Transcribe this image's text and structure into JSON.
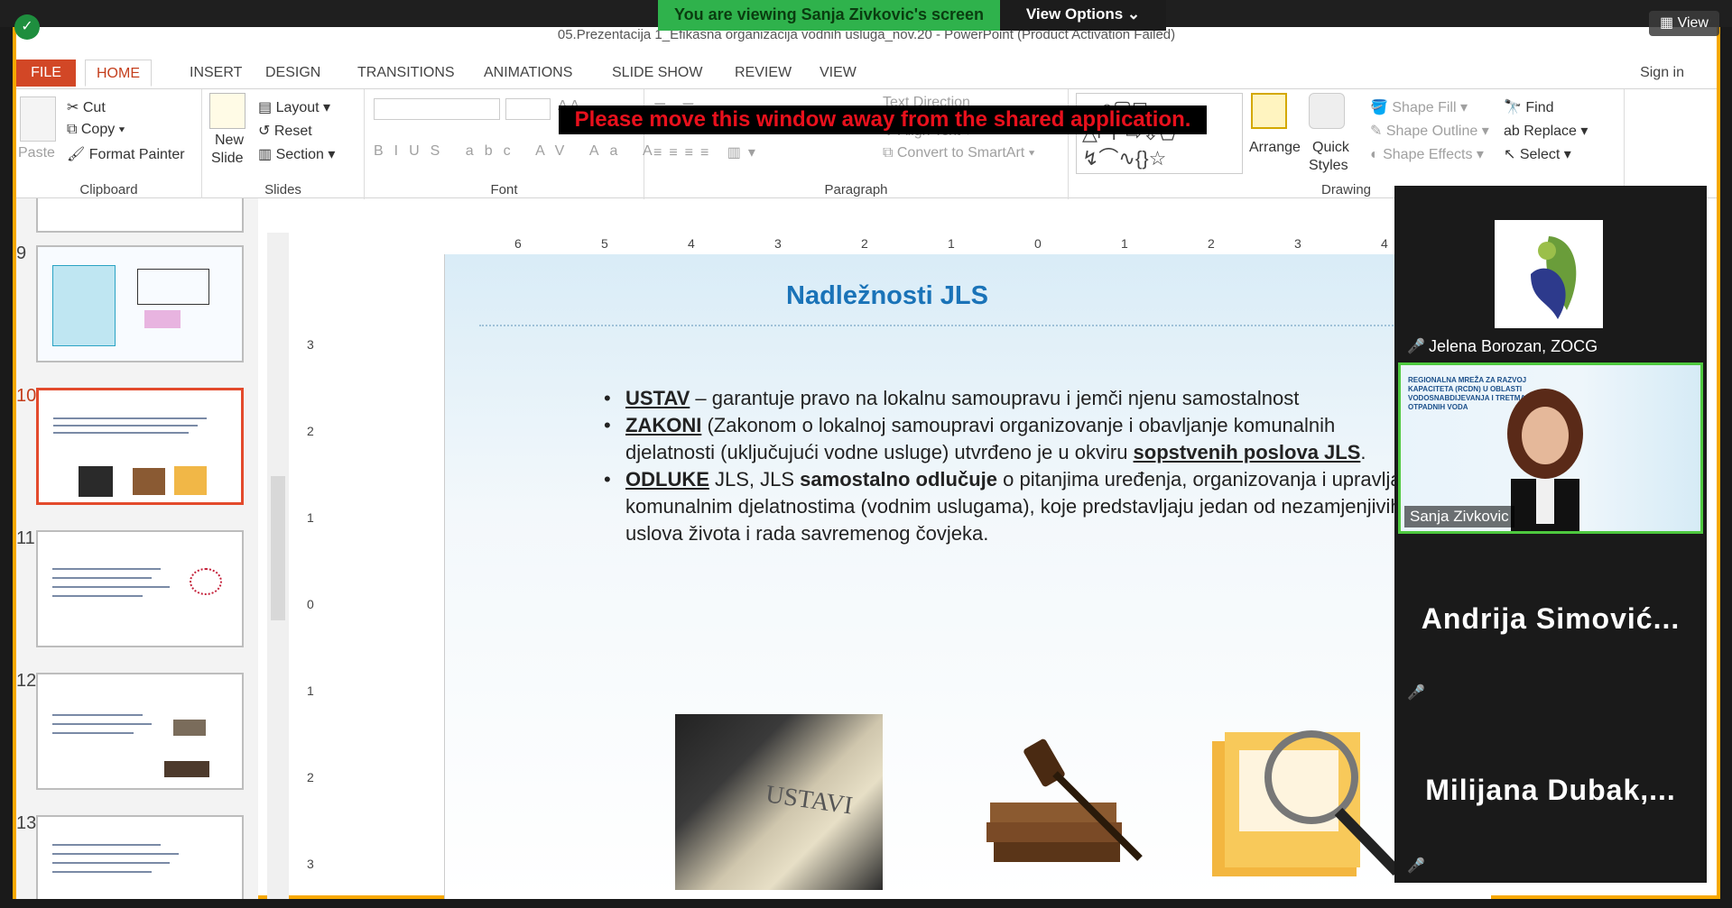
{
  "zoom": {
    "viewing_banner": "You are viewing Sanja Zivkovic's screen",
    "view_options": "View Options",
    "view_button": "View",
    "share_warning": "Please move this window away from the shared application."
  },
  "ppt": {
    "title": "05.Prezentacija 1_Efikasna organizacija vodnih usluga_nov.20 - PowerPoint (Product Activation Failed)",
    "tabs": [
      "FILE",
      "HOME",
      "INSERT",
      "DESIGN",
      "TRANSITIONS",
      "ANIMATIONS",
      "SLIDE SHOW",
      "REVIEW",
      "VIEW"
    ],
    "sign_in": "Sign in",
    "clipboard": {
      "paste": "Paste",
      "cut": "Cut",
      "copy": "Copy",
      "format_painter": "Format Painter",
      "label": "Clipboard"
    },
    "slides_group": {
      "new_slide_1": "New",
      "new_slide_2": "Slide",
      "layout": "Layout",
      "reset": "Reset",
      "section": "Section",
      "label": "Slides"
    },
    "font_group": {
      "label": "Font"
    },
    "paragraph_group": {
      "text_direction": "Text Direction",
      "align_text": "Align Text",
      "convert": "Convert to SmartArt",
      "label": "Paragraph"
    },
    "drawing_group": {
      "arrange": "Arrange",
      "quick_styles_1": "Quick",
      "quick_styles_2": "Styles",
      "shape_fill": "Shape Fill",
      "shape_outline": "Shape Outline",
      "shape_effects": "Shape Effects",
      "label": "Drawing"
    },
    "editing_group": {
      "find": "Find",
      "replace": "Replace",
      "select": "Select"
    },
    "ruler_h": [
      "6",
      "5",
      "4",
      "3",
      "2",
      "1",
      "0",
      "1",
      "2",
      "3",
      "4"
    ],
    "ruler_v": [
      "3",
      "2",
      "1",
      "0",
      "1",
      "2",
      "3"
    ],
    "thumb_numbers": [
      "9",
      "10",
      "11",
      "12",
      "13"
    ],
    "slide": {
      "title": "Nadležnosti JLS",
      "b1_key": "USTAV",
      "b1_text": " – garantuje pravo na lokalnu samoupravu i jemči njenu samostalnost",
      "b2_key": "ZAKONI",
      "b2_text": " (Zakonom o lokalnoj samoupravi organizovanje i obavljanje komunalnih djelatnosti (uključujući vodne usluge) utvrđeno je u okviru ",
      "b2_bold": "sopstvenih poslova JLS",
      "b2_end": ".",
      "b3_key": "ODLUKE",
      "b3_text1": " JLS, JLS ",
      "b3_bold": "samostalno odlučuje",
      "b3_text2": " o pitanjima uređenja, organizovanja i upravljanja komunalnim djelatnostima (vodnim uslugama), koje predstavljaju jedan od nezamjenjivih uslova života i rada savremenog čovjeka.",
      "image_book_label": "USTAVI"
    }
  },
  "participants": {
    "p1": "Jelena Borozan, ZOCG",
    "p2": "Sanja Zivkovic",
    "p3": "Andrija Simović...",
    "p4": "Milijana Dubak,...",
    "p2_slide_text": "REGIONALNA MREŽA ZA RAZVOJ KAPACITETA (RCDN) U OBLASTI VODOSNABDIJEVANJA I TRETMANA OTPADNIH VODA"
  }
}
